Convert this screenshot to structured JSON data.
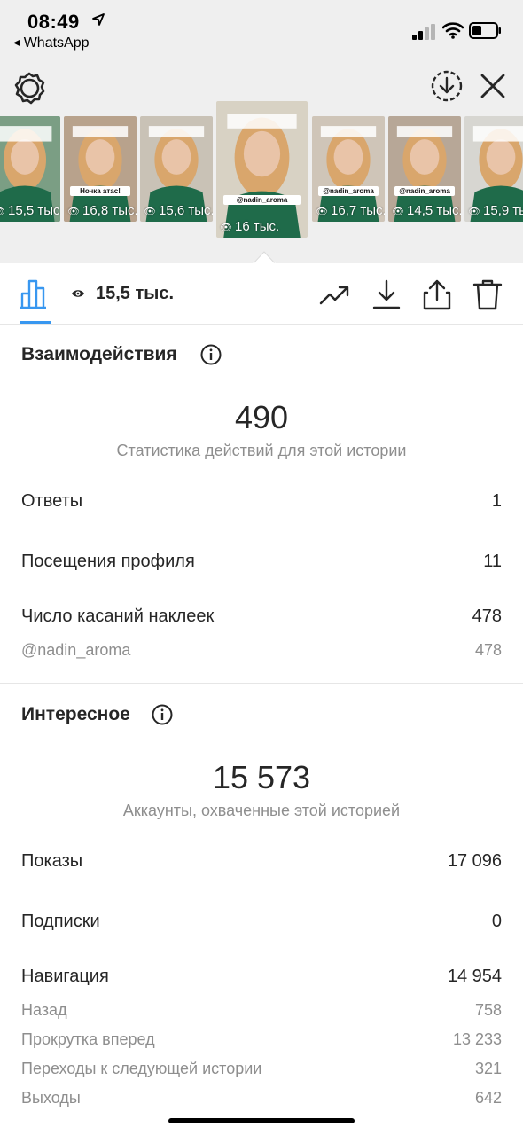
{
  "status": {
    "time": "08:49",
    "back_app": "WhatsApp"
  },
  "stories": [
    {
      "views": "15,5 тыс.",
      "bg": "#7b9e84",
      "caption_lines": 3
    },
    {
      "views": "16,8 тыс.",
      "bg": "#b8a28c",
      "caption_text": "Ночка атас!",
      "caption_lines": 2
    },
    {
      "views": "15,6 тыс.",
      "bg": "#c9c2b6",
      "caption_lines": 2
    },
    {
      "views": "16 тыс.",
      "bg": "#d8d2c4",
      "caption_text": "@nadin_aroma",
      "caption_lines": 2
    },
    {
      "views": "16,7 тыс.",
      "bg": "#cfc5b8",
      "caption_text": "@nadin_aroma",
      "caption_lines": 2
    },
    {
      "views": "14,5 тыс.",
      "bg": "#b7a797",
      "caption_text": "@nadin_aroma",
      "caption_lines": 2
    },
    {
      "views": "15,9 тыс.",
      "bg": "#d7d6d1",
      "caption_lines": 3
    }
  ],
  "toolbar": {
    "views": "15,5 тыс."
  },
  "interactions": {
    "title": "Взаимодействия",
    "total": "490",
    "subtitle": "Статистика действий для этой истории",
    "rows": [
      {
        "label": "Ответы",
        "value": "1"
      },
      {
        "label": "Посещения профиля",
        "value": "11"
      },
      {
        "label": "Число касаний наклеек",
        "value": "478"
      }
    ],
    "sub_rows": [
      {
        "label": "@nadin_aroma",
        "value": "478"
      }
    ]
  },
  "discovery": {
    "title": "Интересное",
    "total": "15 573",
    "subtitle": "Аккаунты, охваченные этой историей",
    "rows": [
      {
        "label": "Показы",
        "value": "17 096"
      },
      {
        "label": "Подписки",
        "value": "0"
      },
      {
        "label": "Навигация",
        "value": "14 954"
      }
    ],
    "sub_rows": [
      {
        "label": "Назад",
        "value": "758"
      },
      {
        "label": "Прокрутка вперед",
        "value": "13 233"
      },
      {
        "label": "Переходы к следующей истории",
        "value": "321"
      },
      {
        "label": "Выходы",
        "value": "642"
      }
    ]
  },
  "colors": {
    "accent": "#3897f0",
    "text": "#262626",
    "muted": "#8e8e8e",
    "strip_bg": "#efefef",
    "sweater": "#1f6b4a",
    "hair": "#d9a66c"
  },
  "icons": [
    "location-arrow-icon",
    "signal-icon",
    "wifi-icon",
    "battery-icon",
    "gear-icon",
    "download-circle-icon",
    "close-icon",
    "eye-icon",
    "bar-chart-icon",
    "trend-icon",
    "download-icon",
    "share-icon",
    "trash-icon",
    "info-icon"
  ]
}
